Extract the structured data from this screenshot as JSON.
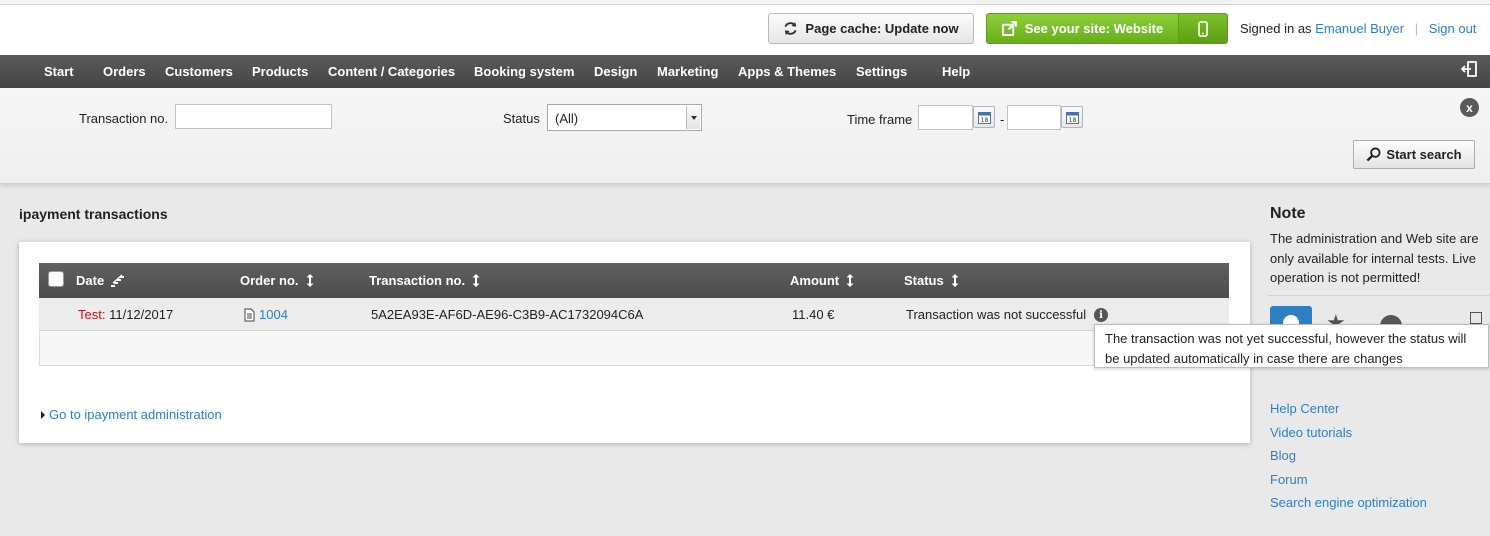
{
  "header": {
    "page_cache_label": "Page cache: Update now",
    "see_site_label": "See your site: Website",
    "signed_in_prefix": "Signed in as",
    "user_name": "Emanuel Buyer",
    "sign_out_label": "Sign out"
  },
  "nav": {
    "items": [
      "Start",
      "Orders",
      "Customers",
      "Products",
      "Content / Categories",
      "Booking system",
      "Design",
      "Marketing",
      "Apps & Themes",
      "Settings",
      "Help"
    ]
  },
  "search": {
    "transaction_label": "Transaction no.",
    "transaction_value": "",
    "status_label": "Status",
    "status_value": "(All)",
    "timeframe_label": "Time frame",
    "timeframe_from": "",
    "timeframe_separator": "-",
    "timeframe_to": "",
    "close_label": "x",
    "start_search_label": "Start search"
  },
  "main": {
    "title": "ipayment transactions",
    "table": {
      "columns": [
        "Date",
        "Order no.",
        "Transaction no.",
        "Amount",
        "Status"
      ],
      "rows": [
        {
          "test_prefix": "Test:",
          "date": "11/12/2017",
          "order_no": "1004",
          "transaction_no": "5A2EA93E-AF6D-AE96-C3B9-AC1732094C6A",
          "amount": "11.40 €",
          "status": "Transaction was not successful"
        }
      ]
    },
    "admin_link": "Go to ipayment administration"
  },
  "tooltip": {
    "text": "The transaction was not yet successful, however the status will be updated automatically in case there are changes"
  },
  "sidebar": {
    "note_title": "Note",
    "note_text": "The administration and Web site are only available for internal tests. Live operation is not permitted!",
    "help_links": [
      "Help Center",
      "Video tutorials",
      "Blog",
      "Forum",
      "Search engine optimization"
    ]
  },
  "colors": {
    "link": "#2f7fc1",
    "green_button": "#7ab929",
    "nav_bg": "#4e4e4e",
    "test_red": "#c0181f"
  }
}
